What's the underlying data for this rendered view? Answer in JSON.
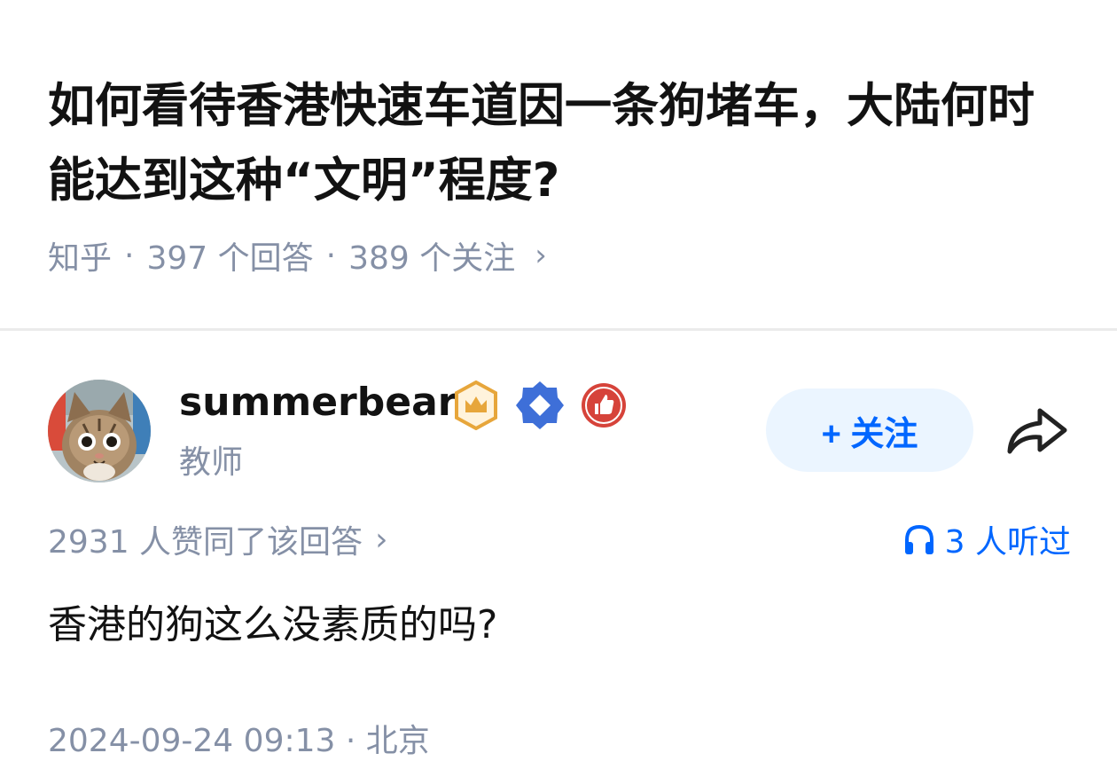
{
  "question": {
    "title": "如何看待香港快速车道因一条狗堵车，大陆何时能达到这种“文明”程度?",
    "source": "知乎",
    "answers": "397 个回答",
    "followers": "389 个关注"
  },
  "author": {
    "name": "summerbear",
    "title": "教师",
    "follow_label": "+ 关注"
  },
  "answer": {
    "vote_summary": "2931 人赞同了该回答",
    "listen_count": "3 人听过",
    "text": "香港的狗这么没素质的吗?",
    "footer_partial": "2024-09-24 09:13 · 北京"
  },
  "colors": {
    "accent": "#0066ff",
    "meta": "#8590a6",
    "follow_bg": "#ebf5ff",
    "divider": "#ebebeb"
  }
}
